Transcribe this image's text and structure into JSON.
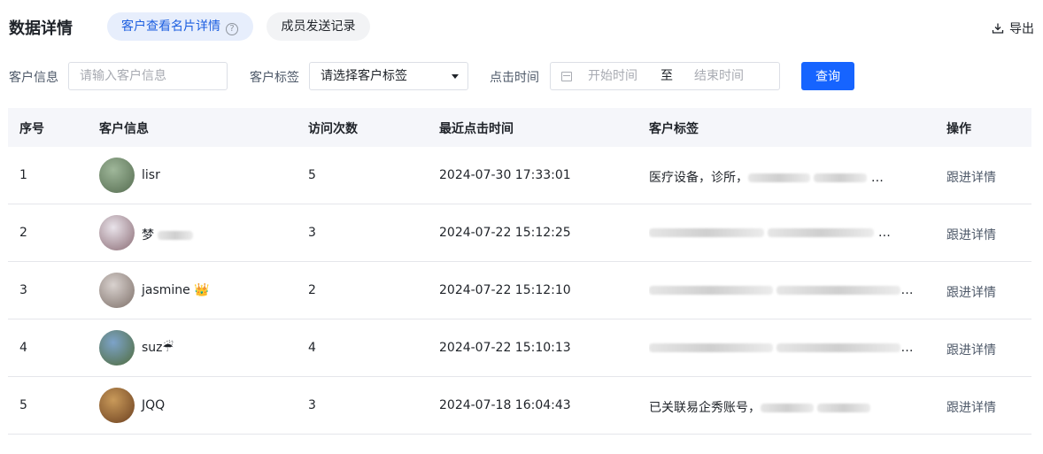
{
  "header": {
    "title": "数据详情",
    "tabs": [
      {
        "label": "客户查看名片详情"
      },
      {
        "label": "成员发送记录"
      }
    ],
    "export_label": "导出"
  },
  "filters": {
    "customer_label": "客户信息",
    "customer_placeholder": "请输入客户信息",
    "tag_label": "客户标签",
    "tag_select_value": "请选择客户标签",
    "time_label": "点击时间",
    "start_placeholder": "开始时间",
    "range_separator": "至",
    "end_placeholder": "结束时间",
    "query_label": "查询"
  },
  "table": {
    "columns": [
      "序号",
      "客户信息",
      "访问次数",
      "最近点击时间",
      "客户标签",
      "操作"
    ],
    "rows": [
      {
        "index": "1",
        "name": "lisr",
        "visits": "5",
        "time": "2024-07-30 17:33:01",
        "tags": "医疗设备，诊所，",
        "action": "跟进详情",
        "avatar_colors": [
          "#9fb79a",
          "#546b4f"
        ]
      },
      {
        "index": "2",
        "name": "梦",
        "visits": "3",
        "time": "2024-07-22 15:12:25",
        "tags": "",
        "action": "跟进详情",
        "avatar_colors": [
          "#e9e3ea",
          "#8a6b74"
        ]
      },
      {
        "index": "3",
        "name": "jasmine 👑",
        "visits": "2",
        "time": "2024-07-22 15:12:10",
        "tags": "",
        "action": "跟进详情",
        "avatar_colors": [
          "#d9d2cf",
          "#7d6f68"
        ]
      },
      {
        "index": "4",
        "name": "suz☔",
        "visits": "4",
        "time": "2024-07-22 15:10:13",
        "tags": "",
        "action": "跟进详情",
        "avatar_colors": [
          "#7da3c9",
          "#4f6b3a"
        ]
      },
      {
        "index": "5",
        "name": "JQQ",
        "visits": "3",
        "time": "2024-07-18 16:04:43",
        "tags": "已关联易企秀账号，",
        "action": "跟进详情",
        "avatar_colors": [
          "#c99a5a",
          "#6b3f1f"
        ]
      }
    ]
  },
  "colors": {
    "primary": "#1664ff",
    "tab_active_bg": "#e7eefc",
    "tab_active_text": "#1d5fe0",
    "table_header_bg": "#f5f6fa"
  }
}
